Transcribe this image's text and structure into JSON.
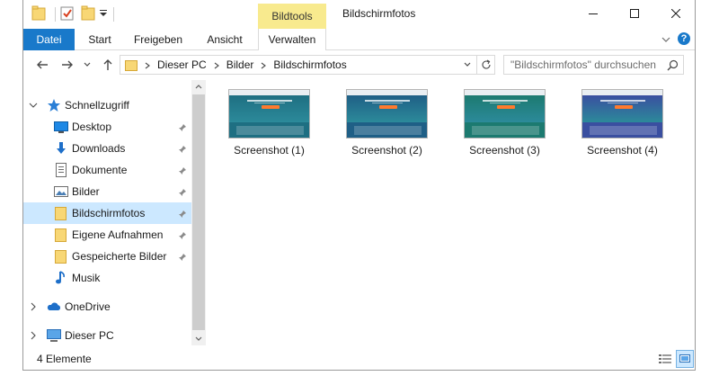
{
  "window": {
    "title": "Bildschirmfotos",
    "context_tab_header": "Bildtools"
  },
  "ribbon": {
    "tabs": [
      {
        "label": "Datei"
      },
      {
        "label": "Start"
      },
      {
        "label": "Freigeben"
      },
      {
        "label": "Ansicht"
      },
      {
        "label": "Verwalten"
      }
    ],
    "help_label": "?"
  },
  "address": {
    "breadcrumbs": [
      "Dieser PC",
      "Bilder",
      "Bildschirmfotos"
    ],
    "search_placeholder": "\"Bildschirmfotos\" durchsuchen"
  },
  "navpane": {
    "items": [
      {
        "label": "Schnellzugriff",
        "icon": "star-icon"
      },
      {
        "label": "Desktop",
        "icon": "desktop-icon"
      },
      {
        "label": "Downloads",
        "icon": "download-icon"
      },
      {
        "label": "Dokumente",
        "icon": "document-icon"
      },
      {
        "label": "Bilder",
        "icon": "pictures-icon"
      },
      {
        "label": "Bildschirmfotos",
        "icon": "folder-icon"
      },
      {
        "label": "Eigene Aufnahmen",
        "icon": "folder-icon"
      },
      {
        "label": "Gespeicherte Bilder",
        "icon": "folder-icon"
      },
      {
        "label": "Musik",
        "icon": "music-icon"
      },
      {
        "label": "OneDrive",
        "icon": "cloud-icon"
      },
      {
        "label": "Dieser PC",
        "icon": "computer-icon"
      }
    ],
    "selected": "Bildschirmfotos"
  },
  "files": [
    {
      "name": "Screenshot (1)",
      "tone": "#1e6f82"
    },
    {
      "name": "Screenshot (2)",
      "tone": "#1f5f86"
    },
    {
      "name": "Screenshot (3)",
      "tone": "#1c7a70"
    },
    {
      "name": "Screenshot (4)",
      "tone": "#3a4fa0"
    }
  ],
  "status": {
    "item_count": "4 Elemente"
  },
  "colors": {
    "accent": "#1979ca",
    "context_tab": "#f8ea8e",
    "selection": "#cce8ff",
    "folder": "#f8d775"
  }
}
